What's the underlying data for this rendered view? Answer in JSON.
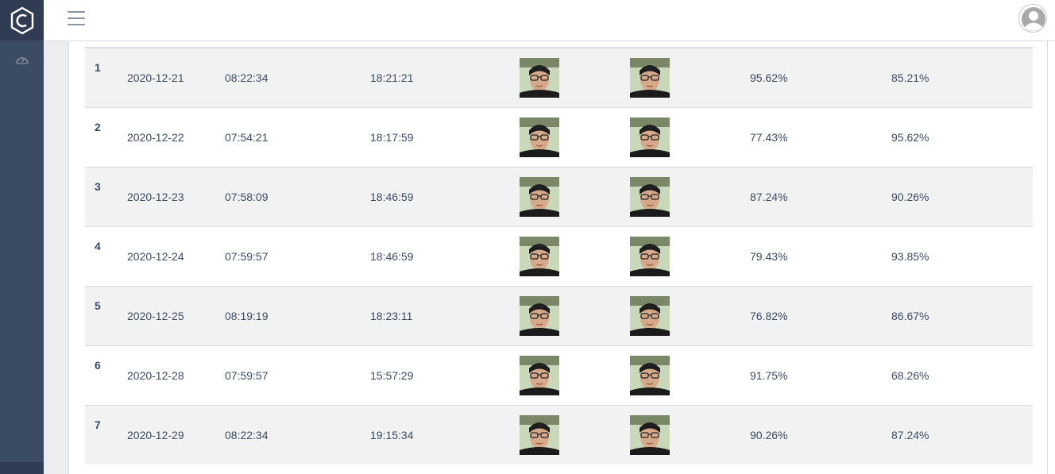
{
  "header": {
    "menu_icon": "hamburger-icon",
    "avatar_icon": "user-avatar-icon"
  },
  "sidebar": {
    "logo_icon": "hexagon-c-logo",
    "items": [
      {
        "icon": "speedometer-icon"
      }
    ]
  },
  "colors": {
    "sidebar": "#3c4b64",
    "sidebar_brand": "#303c54",
    "text": "#3c4b64",
    "stripe": "#f2f2f2",
    "border": "#d8dbe0"
  },
  "table": {
    "rows": [
      {
        "no": "1",
        "date": "2020-12-21",
        "time_in": "08:22:34",
        "time_out": "18:21:21",
        "score_in": "95.62%",
        "score_out": "85.21%"
      },
      {
        "no": "2",
        "date": "2020-12-22",
        "time_in": "07:54:21",
        "time_out": "18:17:59",
        "score_in": "77.43%",
        "score_out": "95.62%"
      },
      {
        "no": "3",
        "date": "2020-12-23",
        "time_in": "07:58:09",
        "time_out": "18:46:59",
        "score_in": "87.24%",
        "score_out": "90.26%"
      },
      {
        "no": "4",
        "date": "2020-12-24",
        "time_in": "07:59:57",
        "time_out": "18:46:59",
        "score_in": "79.43%",
        "score_out": "93.85%"
      },
      {
        "no": "5",
        "date": "2020-12-25",
        "time_in": "08:19:19",
        "time_out": "18:23:11",
        "score_in": "76.82%",
        "score_out": "86.67%"
      },
      {
        "no": "6",
        "date": "2020-12-28",
        "time_in": "07:59:57",
        "time_out": "15:57:29",
        "score_in": "91.75%",
        "score_out": "68.26%"
      },
      {
        "no": "7",
        "date": "2020-12-29",
        "time_in": "08:22:34",
        "time_out": "19:15:34",
        "score_in": "90.26%",
        "score_out": "87.24%"
      }
    ]
  }
}
